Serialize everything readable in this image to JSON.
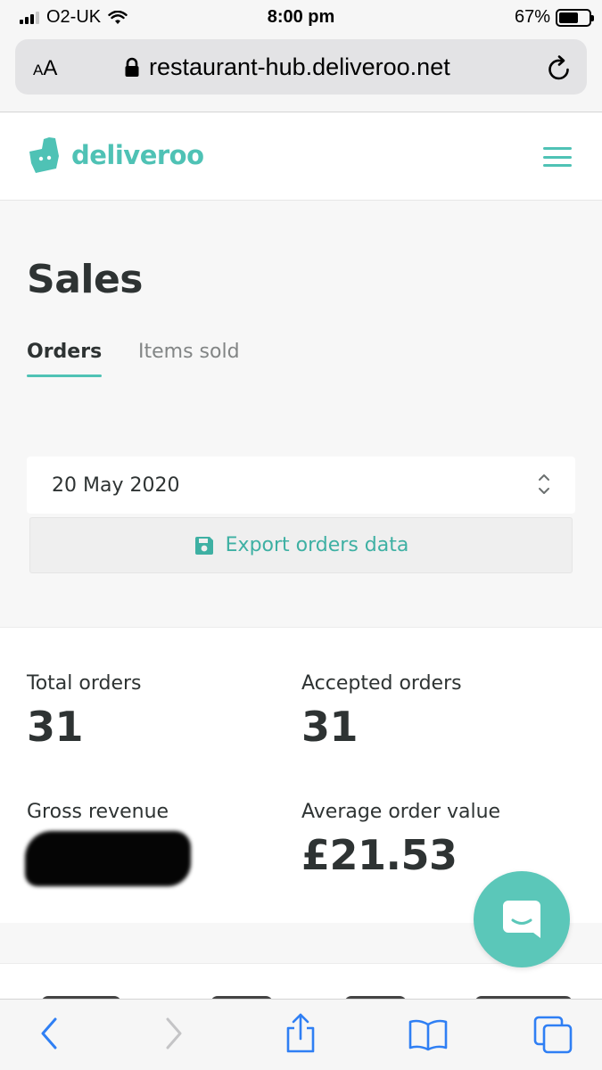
{
  "status_bar": {
    "carrier": "O2-UK",
    "time": "8:00 pm",
    "battery": "67%",
    "battery_level": 0.67
  },
  "browser": {
    "aa_label_small": "A",
    "aa_label_large": "A",
    "url": "restaurant-hub.deliveroo.net"
  },
  "header": {
    "logo_text": "deliveroo"
  },
  "page": {
    "title": "Sales",
    "tabs": [
      {
        "label": "Orders",
        "active": true
      },
      {
        "label": "Items sold",
        "active": false
      }
    ],
    "date_select": {
      "value": "20 May 2020"
    },
    "export_label": "Export orders data"
  },
  "stats": {
    "total_orders_label": "Total orders",
    "total_orders_value": "31",
    "accepted_orders_label": "Accepted orders",
    "accepted_orders_value": "31",
    "gross_revenue_label": "Gross revenue",
    "average_order_value_label": "Average order value",
    "average_order_value": "£21.53"
  },
  "colors": {
    "brand": "#4fc2b5",
    "text": "#2e3333",
    "ios_blue": "#2f7ff4"
  }
}
